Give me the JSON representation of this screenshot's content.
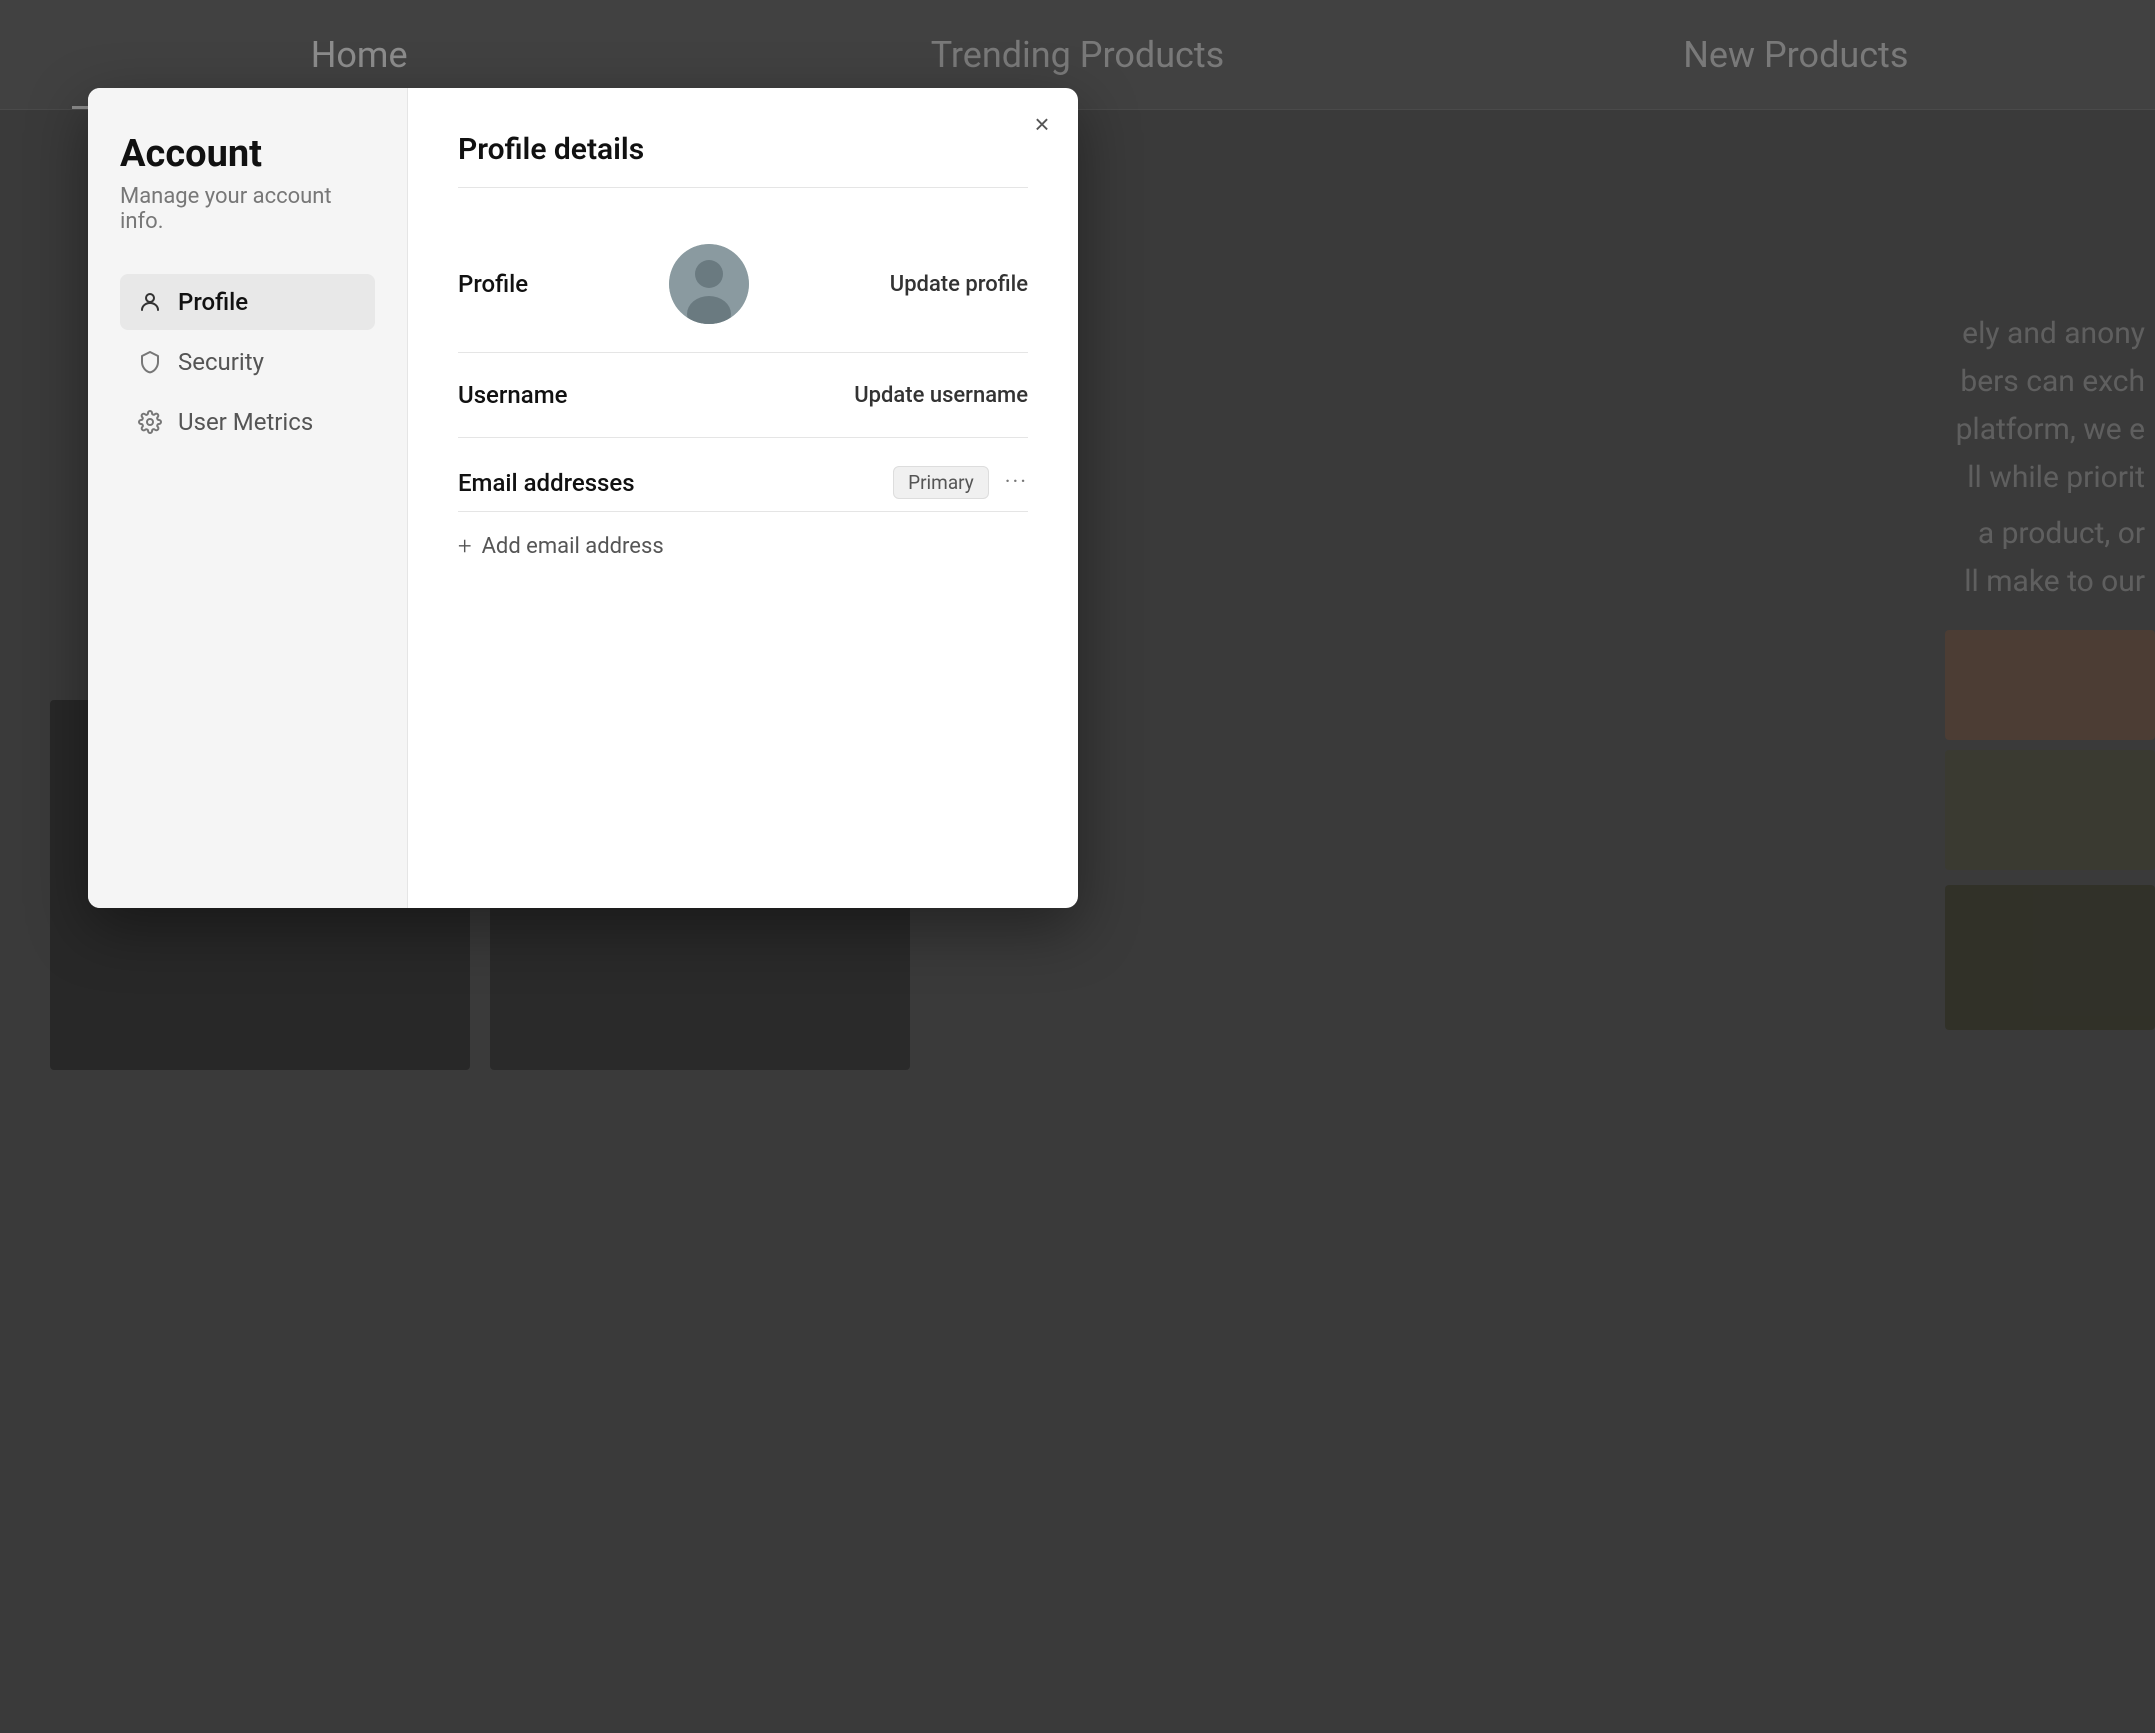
{
  "background": {
    "nav": {
      "items": [
        {
          "id": "home",
          "label": "Home",
          "active": true
        },
        {
          "id": "trending",
          "label": "Trending Products",
          "active": false
        },
        {
          "id": "new",
          "label": "New Products",
          "active": false
        }
      ]
    },
    "content_text_1": "ely and anony",
    "content_text_2": "bers can exch",
    "content_text_3": "platform, we e",
    "content_text_4": "ll while priorit",
    "content_text_5": "a product, or",
    "content_text_6": "ll make to our"
  },
  "modal": {
    "sidebar": {
      "title": "Account",
      "subtitle": "Manage your account info.",
      "nav_items": [
        {
          "id": "profile",
          "label": "Profile",
          "icon": "person",
          "active": true
        },
        {
          "id": "security",
          "label": "Security",
          "icon": "shield",
          "active": false
        },
        {
          "id": "metrics",
          "label": "User Metrics",
          "icon": "gear",
          "active": false
        }
      ]
    },
    "main": {
      "title": "Profile details",
      "close_label": "×",
      "sections": {
        "profile": {
          "label": "Profile",
          "action": "Update profile"
        },
        "username": {
          "label": "Username",
          "action": "Update username"
        },
        "email": {
          "label": "Email addresses",
          "badge": "Primary",
          "more": "···",
          "add_label": "Add email address"
        }
      }
    }
  }
}
